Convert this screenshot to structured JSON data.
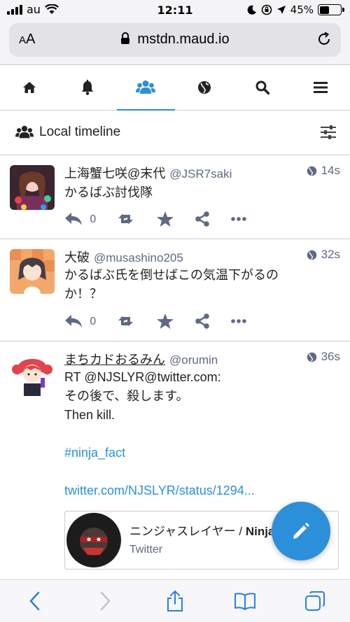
{
  "status_bar": {
    "carrier": "au",
    "time": "12:11",
    "battery": "45%",
    "battery_level": 0.45
  },
  "browser": {
    "text_size_label": "AA",
    "url": "mstdn.maud.io"
  },
  "nav_tabs": [
    {
      "icon": "home-icon"
    },
    {
      "icon": "bell-icon"
    },
    {
      "icon": "users-icon",
      "active": true
    },
    {
      "icon": "globe-icon"
    },
    {
      "icon": "search-icon"
    },
    {
      "icon": "menu-icon"
    }
  ],
  "column": {
    "title": "Local timeline"
  },
  "statuses": [
    {
      "display_name": "上海蟹七咲@末代",
      "acct": "@JSR7saki",
      "time": "14s",
      "content": [
        "かるばぶ討伐隊"
      ],
      "replies": "0"
    },
    {
      "display_name": "大破",
      "acct": "@musashino205",
      "time": "32s",
      "content": [
        "かるばぶ氏を倒せばこの気温下がるの",
        "か！？"
      ],
      "replies": "0"
    },
    {
      "display_name": "まちカドおるみん",
      "acct": "@orumin",
      "time": "36s",
      "content": [
        "RT @NJSLYR@twitter.com:",
        "その後で、殺します。",
        "Then kill."
      ],
      "hashtag": "#ninja_fact",
      "link": "twitter.com/NJSLYR/status/1294...",
      "card": {
        "title_prefix": "ニンジャスレイヤー / ",
        "title_bold": "Ninja",
        "provider": "Twitter"
      }
    }
  ],
  "colors": {
    "accent": "#2b90d9",
    "muted": "#606984",
    "border": "#c8ccd4"
  }
}
